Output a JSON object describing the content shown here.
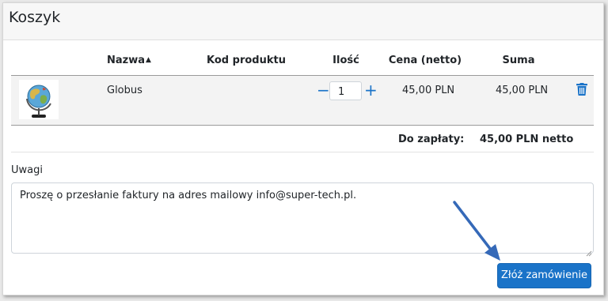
{
  "cart": {
    "title": "Koszyk",
    "columns": {
      "name": "Nazwa",
      "sort_indicator": "▲",
      "code": "Kod produktu",
      "quantity": "Ilość",
      "price": "Cena (netto)",
      "sum": "Suma"
    },
    "items": [
      {
        "name": "Globus",
        "code": "",
        "quantity": "1",
        "price": "45,00 PLN",
        "sum": "45,00 PLN",
        "thumbnail_icon": "globe-icon"
      }
    ],
    "qty_minus": "−",
    "qty_plus": "+",
    "total_label": "Do zapłaty:",
    "total_value": "45,00 PLN netto",
    "notes_label": "Uwagi",
    "notes_value": "Proszę o przesłanie faktury na adres mailowy info@super-tech.pl.",
    "submit_label": "Złóż zamówienie"
  },
  "colors": {
    "accent": "#1a73c8",
    "annotation_arrow": "#3569b8"
  }
}
